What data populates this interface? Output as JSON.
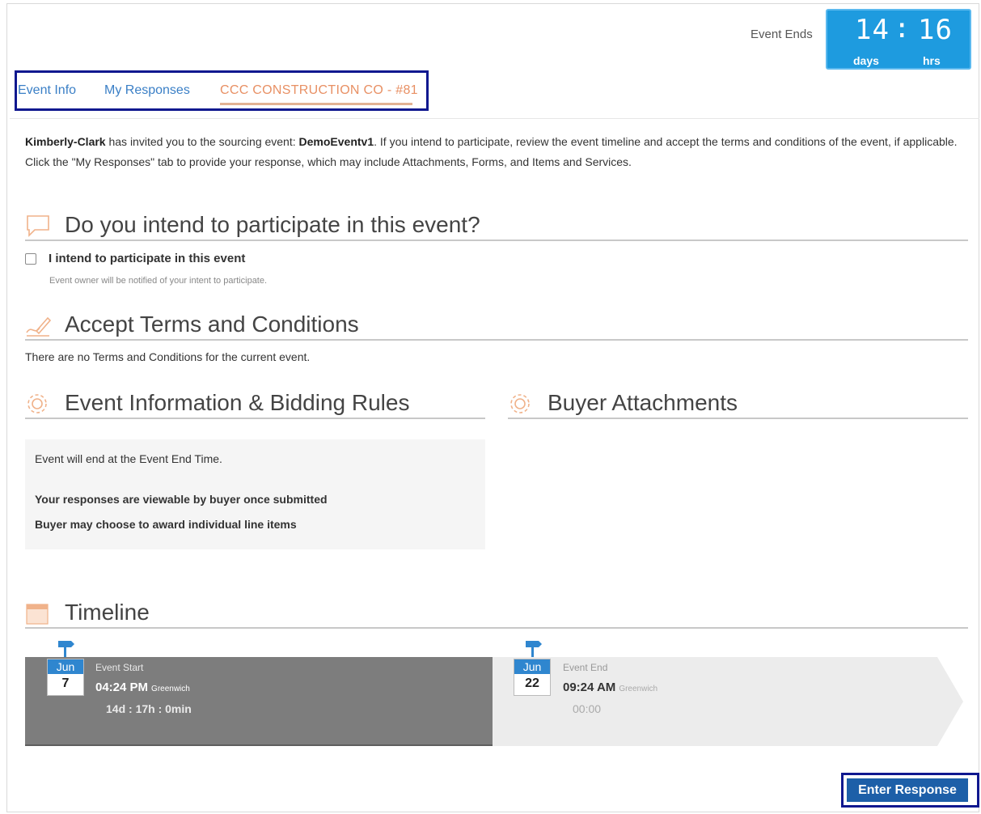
{
  "countdown": {
    "label": "Event Ends",
    "days_value": "14",
    "separator": ":",
    "hours_value": "16",
    "days_label": "days",
    "hours_label": "hrs"
  },
  "tabs": [
    {
      "label": "Event Info"
    },
    {
      "label": "My Responses"
    },
    {
      "label": "CCC CONSTRUCTION CO - #81"
    }
  ],
  "intro": {
    "buyer": "Kimberly-Clark",
    "text1": " has invited you to the sourcing event: ",
    "event_name": "DemoEventv1",
    "text2": ". If you intend to participate, review the event timeline and accept the terms and conditions of the event, if applicable.",
    "line2": "Click the \"My Responses\" tab to provide your response, which may include Attachments, Forms, and Items and Services."
  },
  "participate": {
    "heading": "Do you intend to participate in this event?",
    "checkbox_label": "I intend to participate in this event",
    "note": "Event owner will be notified of your intent to participate."
  },
  "terms": {
    "heading": "Accept Terms and Conditions",
    "text": "There are no Terms and Conditions for the current event."
  },
  "rules": {
    "heading": "Event Information & Bidding Rules",
    "items": [
      "Event will end at the Event End Time.",
      "Your responses are viewable by buyer once submitted",
      "Buyer may choose to award individual line items"
    ]
  },
  "attachments": {
    "heading": "Buyer Attachments"
  },
  "timeline": {
    "heading": "Timeline",
    "start": {
      "month": "Jun",
      "day": "7",
      "label": "Event Start",
      "time": "04:24 PM",
      "tz": "Greenwich",
      "duration": "14d : 17h : 0min"
    },
    "end": {
      "month": "Jun",
      "day": "22",
      "label": "Event End",
      "time": "09:24 AM",
      "tz": "Greenwich",
      "duration": "00:00"
    }
  },
  "actions": {
    "enter_response": "Enter Response"
  },
  "colors": {
    "accent_blue": "#1e9bdf",
    "tab_active": "#e89064",
    "highlight_border": "#10188f",
    "icon_orange": "#f0b28a"
  }
}
